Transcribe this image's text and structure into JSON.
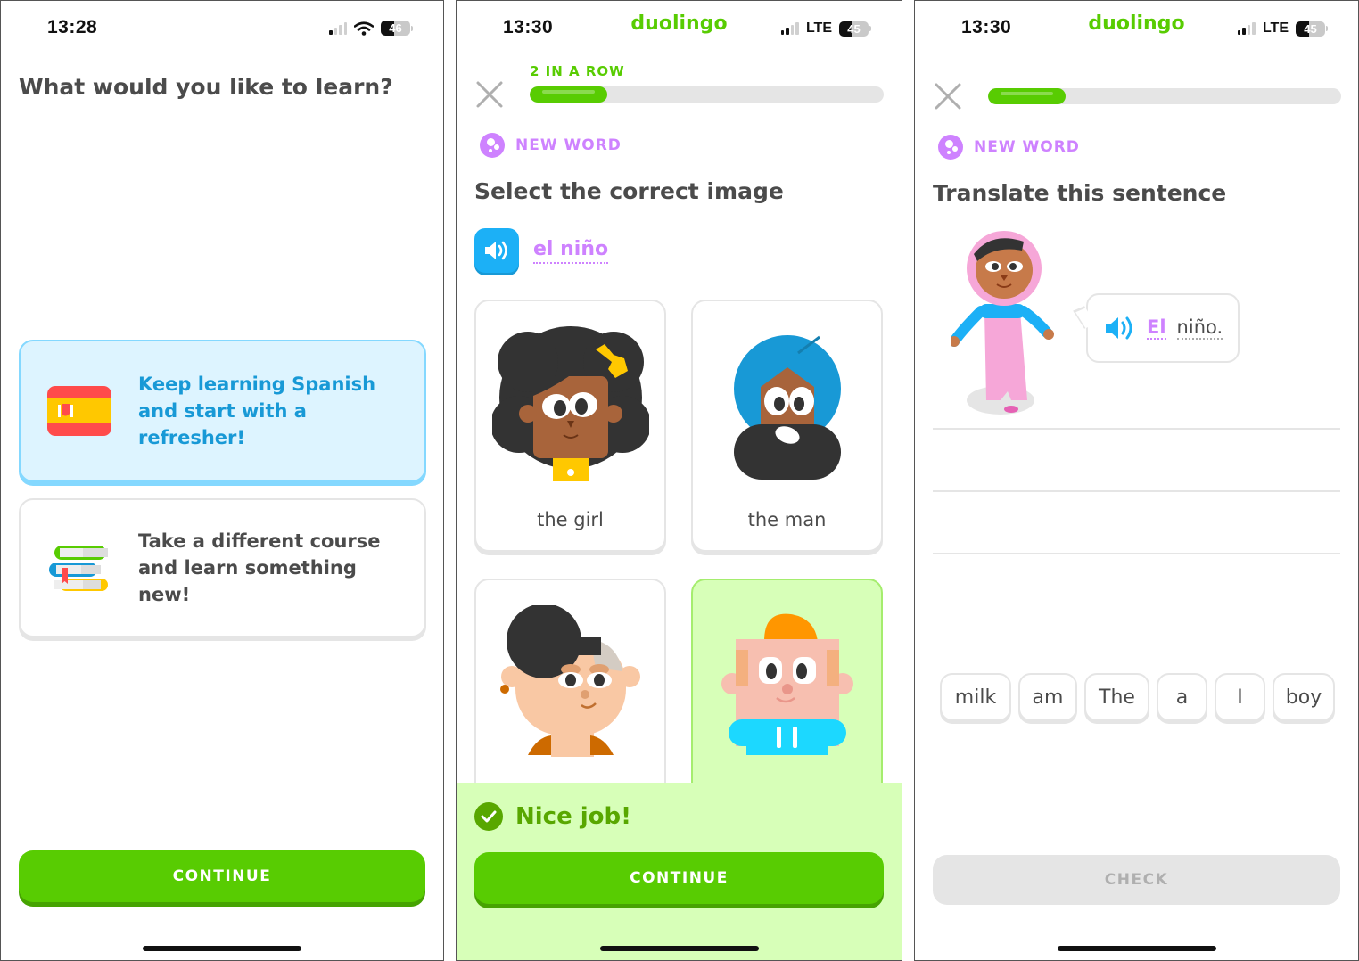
{
  "screens": [
    {
      "status": {
        "time": "13:28",
        "network": "wifi",
        "battery": "46",
        "battery_level": 0.46
      },
      "title": "What would you like to learn?",
      "options": [
        {
          "icon": "spain-flag-icon",
          "label": "Keep learning Spanish and start with a refresher!",
          "selected": true
        },
        {
          "icon": "books-icon",
          "label": "Take a different course and learn something new!",
          "selected": false
        }
      ],
      "continue_label": "CONTINUE"
    },
    {
      "status": {
        "time": "13:30",
        "brand": "duolingo",
        "network": "LTE",
        "battery": "45",
        "battery_level": 0.45
      },
      "streak_label": "2 IN A ROW",
      "progress": 0.22,
      "badge_label": "NEW WORD",
      "prompt": "Select the correct image",
      "word": "el niño",
      "choices": [
        {
          "label": "the girl",
          "icon": "girl-avatar"
        },
        {
          "label": "the man",
          "icon": "man-avatar"
        },
        {
          "label": "",
          "icon": "woman-avatar"
        },
        {
          "label": "",
          "icon": "boy-avatar",
          "correct": true
        }
      ],
      "feedback": {
        "text": "Nice job!",
        "button": "CONTINUE"
      }
    },
    {
      "status": {
        "time": "13:30",
        "brand": "duolingo",
        "network": "LTE",
        "battery": "45",
        "battery_level": 0.45
      },
      "progress": 0.22,
      "badge_label": "NEW WORD",
      "prompt": "Translate this sentence",
      "sentence": {
        "word1": "El",
        "word2": "niño."
      },
      "word_bank": [
        "milk",
        "am",
        "The",
        "a",
        "I",
        "boy"
      ],
      "check_label": "CHECK"
    }
  ],
  "colors": {
    "green": "#58cc02",
    "blue": "#1cb0f6",
    "purple": "#ce82ff",
    "feedback_bg": "#d7ffb8"
  }
}
